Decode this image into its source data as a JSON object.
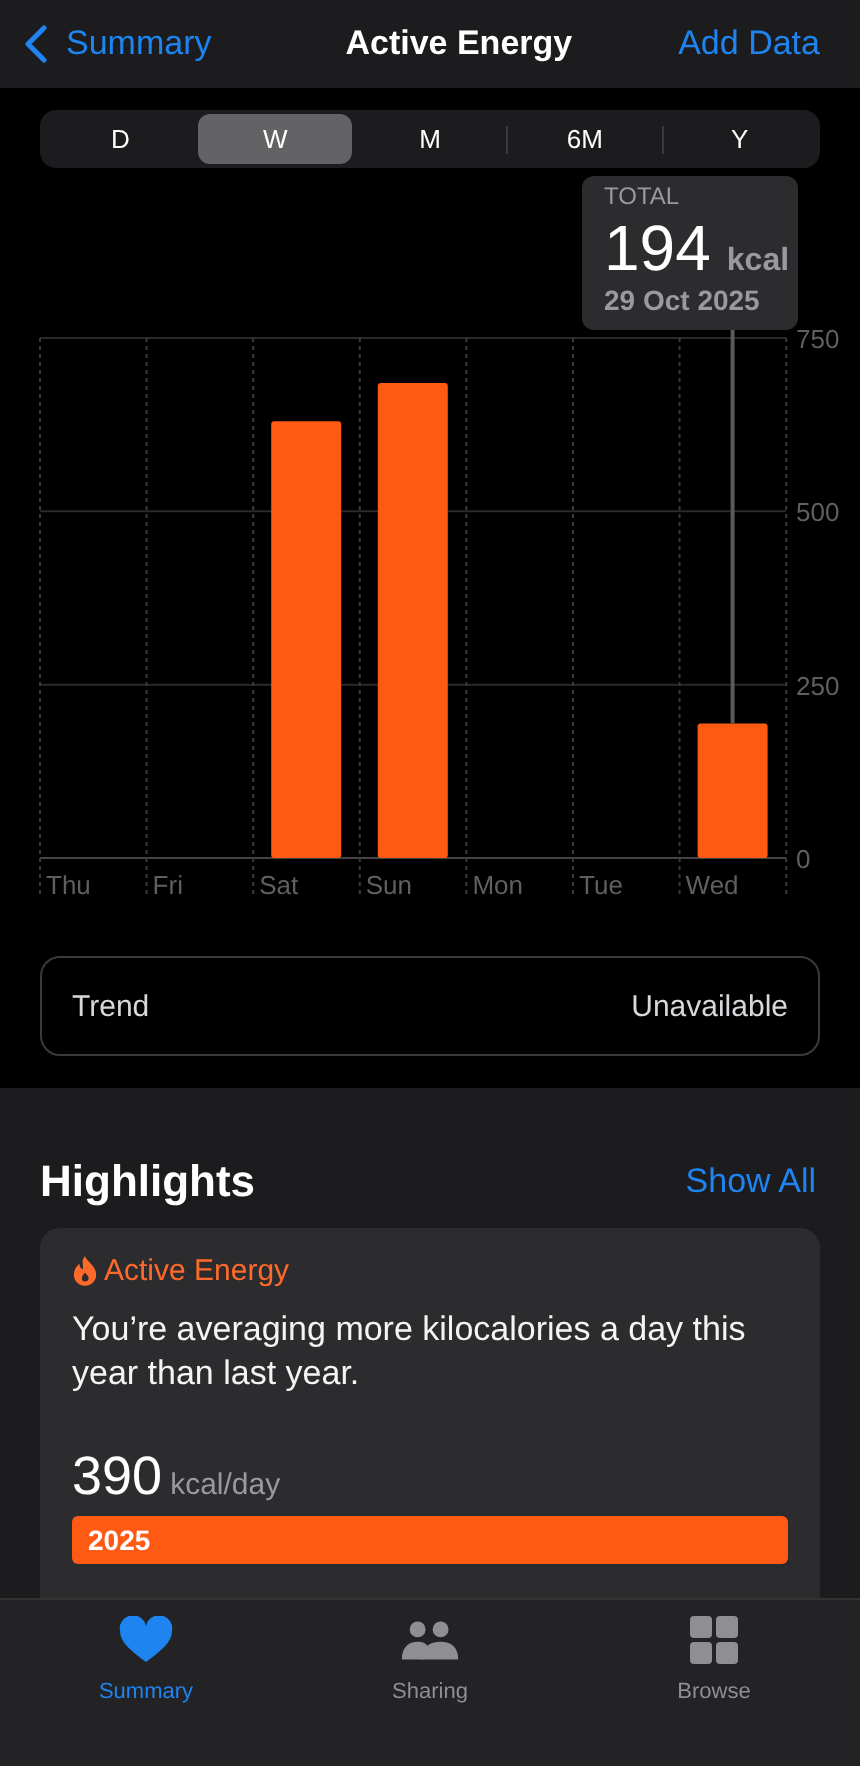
{
  "nav": {
    "back_label": "Summary",
    "title": "Active Energy",
    "action": "Add Data"
  },
  "segments": [
    {
      "label": "D",
      "selected": false
    },
    {
      "label": "W",
      "selected": true
    },
    {
      "label": "M",
      "selected": false
    },
    {
      "label": "6M",
      "selected": false
    },
    {
      "label": "Y",
      "selected": false
    }
  ],
  "tooltip": {
    "label": "TOTAL",
    "value": "194",
    "unit": "kcal",
    "date": "29 Oct 2025"
  },
  "chart_data": {
    "type": "bar",
    "categories": [
      "Thu",
      "Fri",
      "Sat",
      "Sun",
      "Mon",
      "Tue",
      "Wed"
    ],
    "series": [
      {
        "color": "#ff5a14",
        "values": [
          null,
          null,
          630,
          685,
          null,
          null,
          194
        ]
      }
    ],
    "ylim": [
      0,
      750
    ],
    "yticks": [
      0,
      250,
      500,
      750
    ]
  },
  "trend": {
    "label": "Trend",
    "value": "Unavailable"
  },
  "highlights": {
    "title": "Highlights",
    "show_all": "Show All",
    "card": {
      "category": "Active Energy",
      "text": "You’re averaging more kilocalories a day this year than last year.",
      "value": "390",
      "unit": "kcal/day",
      "bar_label": "2025"
    }
  },
  "tabbar": [
    {
      "label": "Summary",
      "selected": true
    },
    {
      "label": "Sharing",
      "selected": false
    },
    {
      "label": "Browse",
      "selected": false
    }
  ]
}
